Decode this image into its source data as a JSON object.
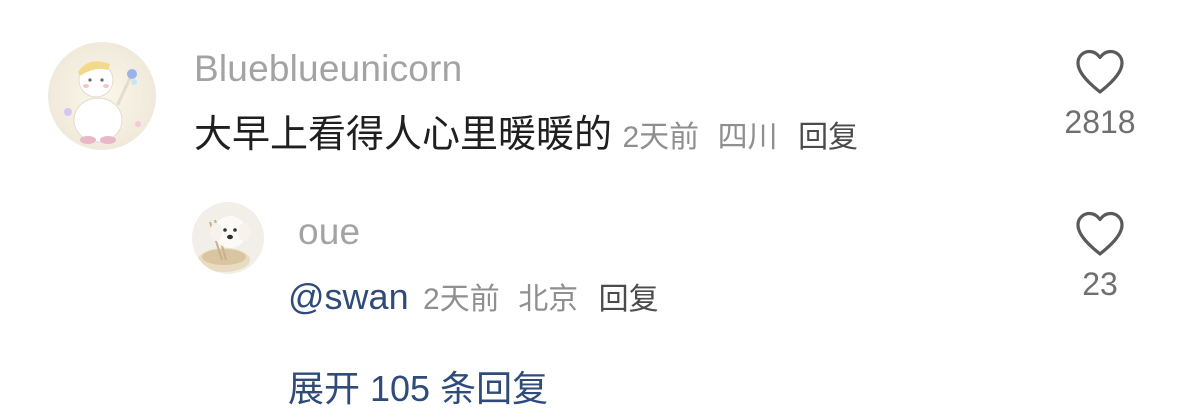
{
  "comment": {
    "username": "Blueblueunicorn",
    "text": "大早上看得人心里暖暖的",
    "time": "2天前",
    "location": "四川",
    "reply_label": "回复",
    "like_count": "2818"
  },
  "reply": {
    "username": "oue",
    "mention": "@swan",
    "time": "2天前",
    "location": "北京",
    "reply_label": "回复",
    "like_count": "23"
  },
  "expand_label": "展开 105 条回复",
  "icons": {
    "like": "heart-outline-icon"
  },
  "colors": {
    "link": "#2f4b7a",
    "username": "#a3a3a3",
    "meta": "#8f8f8f"
  }
}
